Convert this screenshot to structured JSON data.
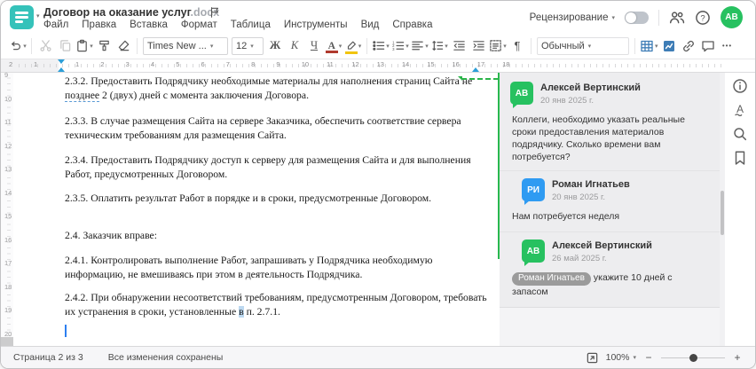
{
  "app": {
    "title": "Договор на оказание услуг",
    "ext": ".docx"
  },
  "menu": {
    "items": [
      "Файл",
      "Правка",
      "Вставка",
      "Формат",
      "Таблица",
      "Инструменты",
      "Вид",
      "Справка"
    ]
  },
  "header": {
    "review_label": "Рецензирование",
    "avatar_initials": "АВ"
  },
  "toolbar": {
    "font_name": "Times New ...",
    "font_size": "12",
    "bold_letter": "Ж",
    "italic_letter": "К",
    "underline_letter": "Ч",
    "color_letter": "А",
    "style_name": "Обычный"
  },
  "ruler": {
    "h_margin_labels": [
      "2",
      "1"
    ],
    "h_labels": [
      "1",
      "2",
      "3",
      "4",
      "5",
      "6",
      "7",
      "8",
      "9",
      "10",
      "11",
      "12",
      "13",
      "14",
      "15",
      "16",
      "17",
      "18"
    ],
    "v_labels": [
      "9",
      "10",
      "11",
      "12",
      "13",
      "14",
      "15",
      "16",
      "17",
      "18",
      "19",
      "20"
    ]
  },
  "doc": {
    "p1": {
      "l1": "2.3.2. Предоставить Подрядчику необходимые материалы для наполнения страниц Сайта не",
      "ins": "позднее",
      "l2rest": " 2 (двух) дней с момента заключения Договора."
    },
    "p2": {
      "l1": "2.3.3. В случае размещения Сайта на сервере Заказчика, обеспечить соответствие сервера",
      "l2": "техническим требованиям для размещения Сайта."
    },
    "p3": {
      "l1": "2.3.4. Предоставить Подрядчику доступ к серверу для размещения Сайта и для выполнения",
      "l2": "Работ, предусмотренных Договором."
    },
    "p4": "2.3.5. Оплатить результат Работ в порядке и в сроки, предусмотренные Договором.",
    "p5": "2.4. Заказчик вправе:",
    "p6": {
      "l1": "2.4.1. Контролировать выполнение Работ, запрашивать у Подрядчика необходимую",
      "l2": "информацию, не вмешиваясь при этом в деятельность Подрядчика."
    },
    "p7": {
      "l1": "2.4.2. При обнаружении несоответствий требованиям, предусмотренным Договором, требовать",
      "l2a": "их устранения в сроки, установленные ",
      "sel": "в",
      "l2b": " п. 2.7.1."
    }
  },
  "comments": {
    "items": [
      {
        "initials": "АВ",
        "name": "Алексей Вертинский",
        "date": "20 янв 2025 г.",
        "text": "Коллеги, необходимо указать реальные сроки предоставления материалов подрядчику. Сколько времени вам потребуется?"
      },
      {
        "initials": "РИ",
        "name": "Роман Игнатьев",
        "date": "20 янв 2025 г.",
        "text": "Нам потребуется неделя"
      },
      {
        "initials": "АВ",
        "name": "Алексей Вертинский",
        "date": "26 май 2025 г.",
        "mention": "Роман Игнатьев",
        "text": "укажите 10 дней с запасом"
      }
    ]
  },
  "status": {
    "page_info": "Страница 2 из 3",
    "saved": "Все изменения сохранены",
    "zoom": "100%",
    "minus": "−",
    "plus": "+"
  },
  "colors": {
    "brand_teal": "#35c2ba",
    "accent_green": "#28b84e",
    "accent_blue": "#2d9fd8",
    "avatar_green": "#27c160",
    "avatar_blue": "#2f9bf2",
    "toolbar_blue": "#3e7db6",
    "mention_bg": "#9b9b9b",
    "selection_blue": "#bcd8f0"
  }
}
